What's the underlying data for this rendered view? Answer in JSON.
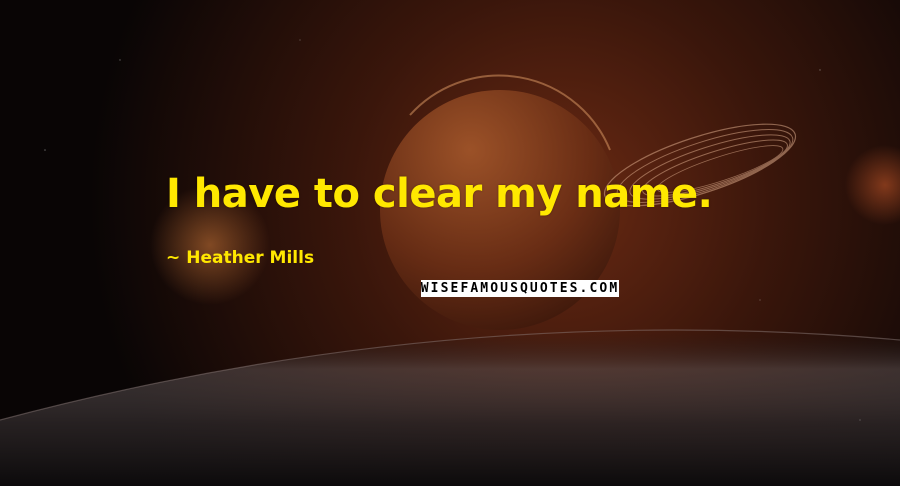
{
  "quote": {
    "text": "I have to clear my name.",
    "author_dash": "~",
    "author": "Heather Mills"
  },
  "brand": {
    "watermark": "WISEFAMOUSQUOTES.COM"
  },
  "colors": {
    "quote_text": "#ffe800",
    "author_text": "#ffe800",
    "badge_background": "#ffffff",
    "badge_text": "#000000"
  }
}
